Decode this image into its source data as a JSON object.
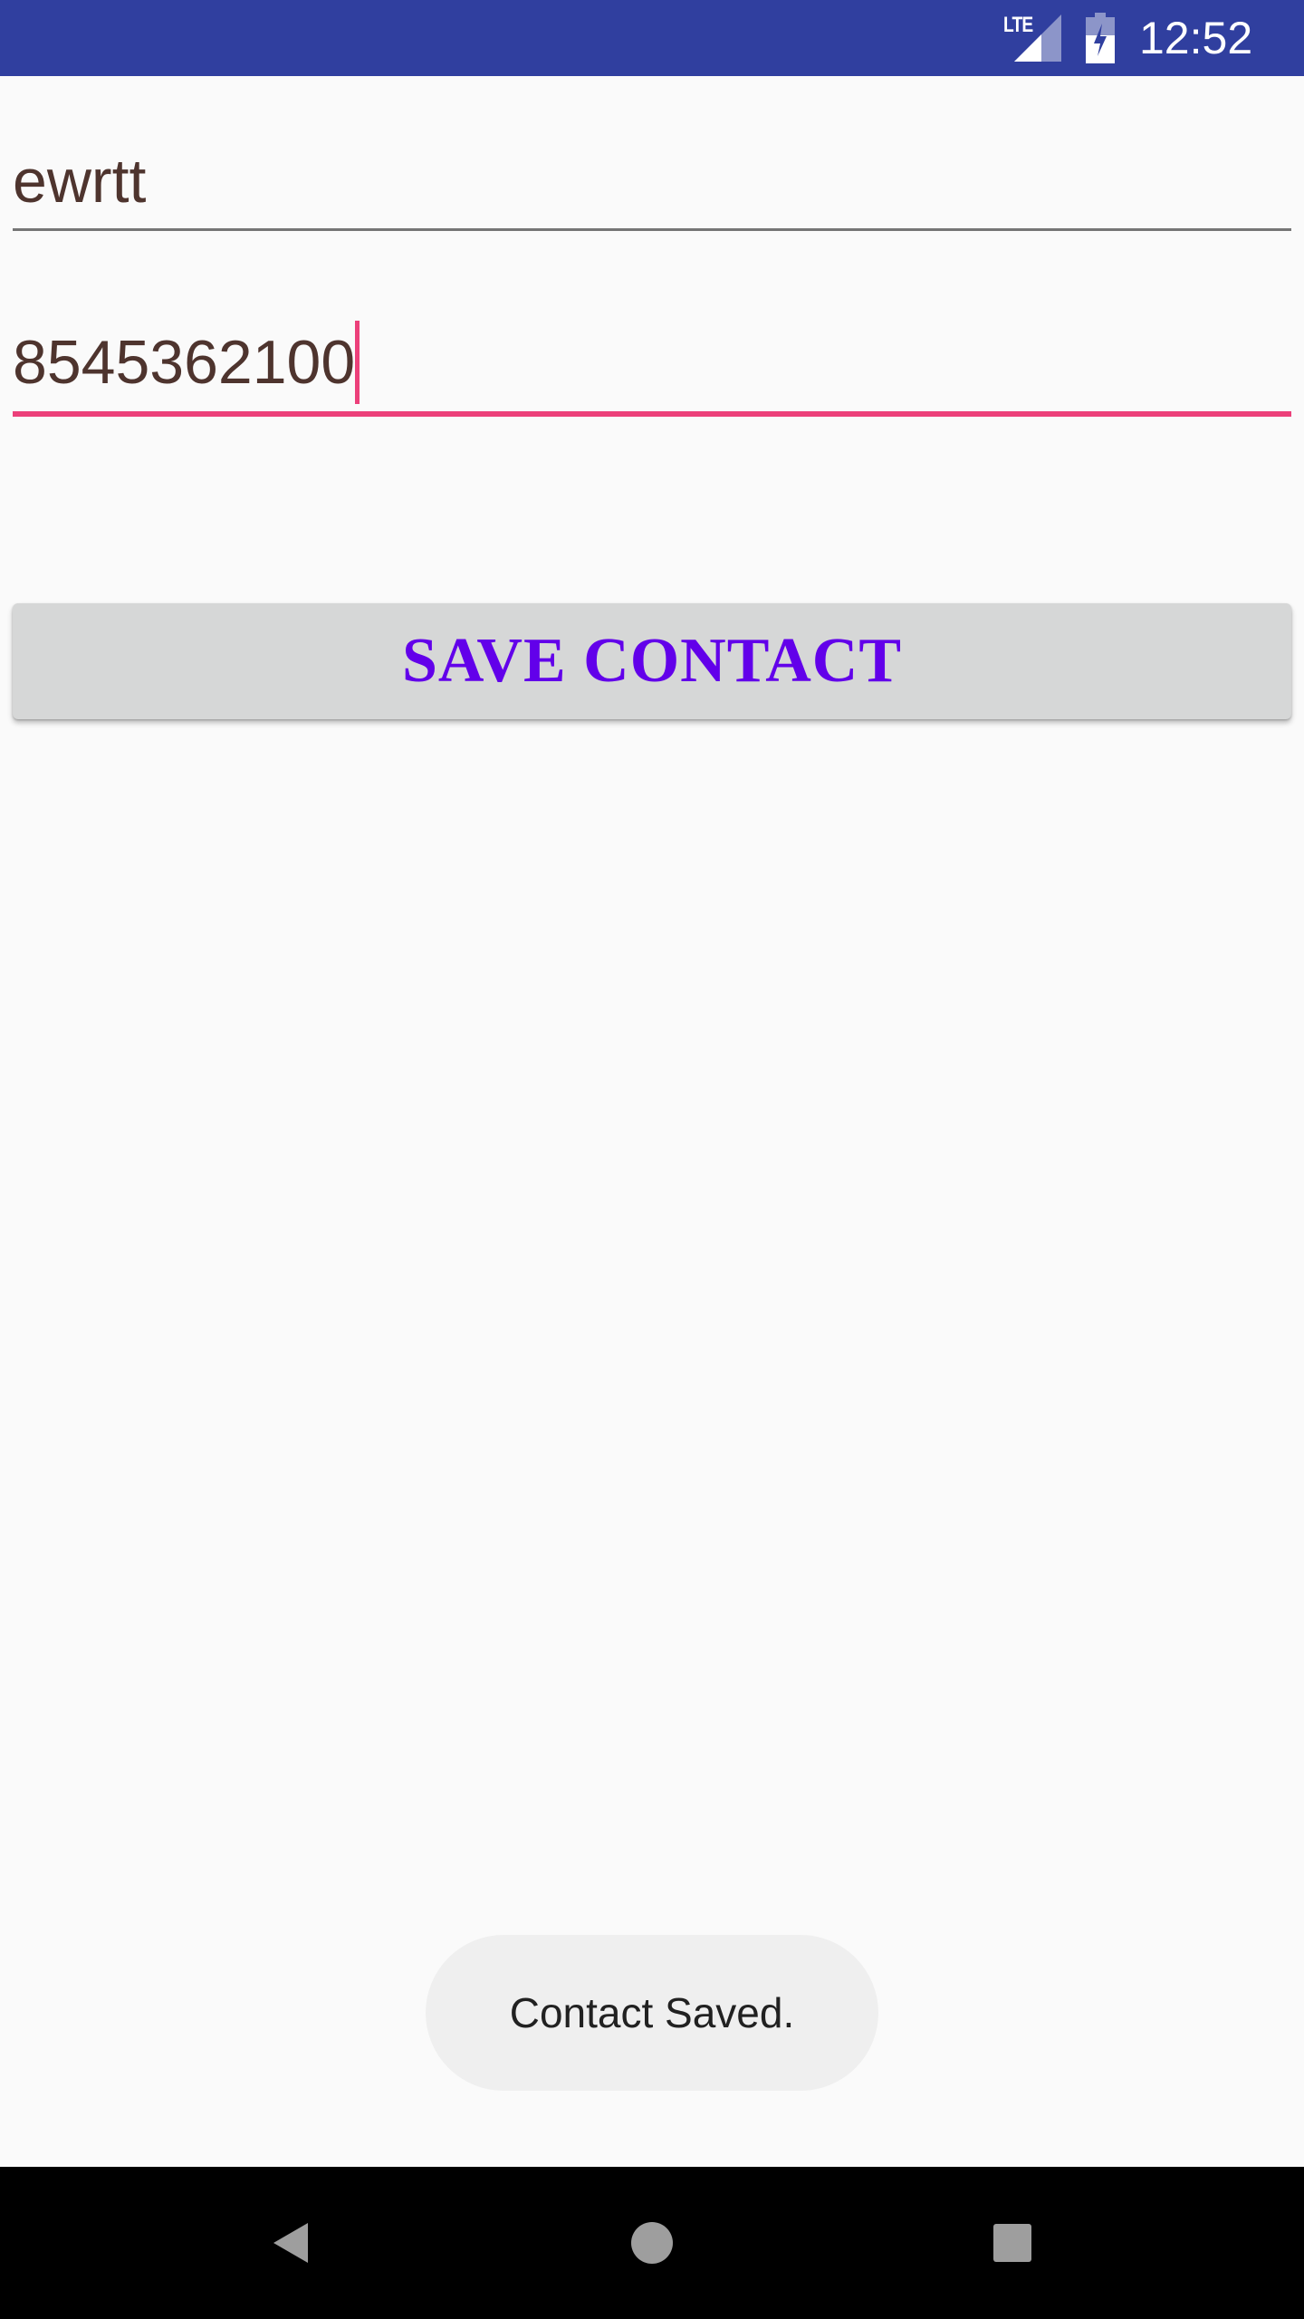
{
  "status_bar": {
    "network_label": "LTE",
    "time": "12:52",
    "signal_icon": "cell-signal-icon",
    "battery_icon": "battery-charging-icon"
  },
  "form": {
    "name_value": "ewrtt",
    "phone_value": "8545362100",
    "save_label": "SAVE CONTACT"
  },
  "toast": {
    "message": "Contact Saved."
  },
  "navigation": {
    "back_icon": "back-triangle-icon",
    "home_icon": "home-circle-icon",
    "recents_icon": "recents-square-icon"
  },
  "colors": {
    "status_bar": "#303f9f",
    "accent": "#ec407a",
    "button_text": "#6200ea",
    "field_text": "#4e342e",
    "button_bg": "#d6d7d7",
    "background": "#fafafa"
  }
}
